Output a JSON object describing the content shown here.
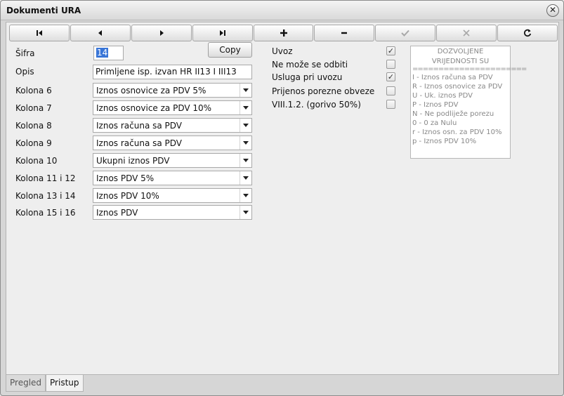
{
  "window": {
    "title": "Dokumenti URA",
    "close_label": "✕"
  },
  "toolbar": {
    "buttons": [
      {
        "name": "first-record-button",
        "icon": "first-icon"
      },
      {
        "name": "prev-record-button",
        "icon": "prev-icon"
      },
      {
        "name": "next-record-button",
        "icon": "next-icon"
      },
      {
        "name": "last-record-button",
        "icon": "last-icon"
      },
      {
        "name": "add-record-button",
        "icon": "plus-icon"
      },
      {
        "name": "delete-record-button",
        "icon": "minus-icon"
      },
      {
        "name": "confirm-button",
        "icon": "check-icon"
      },
      {
        "name": "cancel-button",
        "icon": "x-icon"
      },
      {
        "name": "refresh-button",
        "icon": "refresh-icon"
      }
    ]
  },
  "form": {
    "sifra_label": "Šifra",
    "sifra_value": "14",
    "opis_label": "Opis",
    "opis_value": "Primljene isp. izvan HR II13 I III13",
    "copy_label": "Copy",
    "kolone": [
      {
        "label": "Kolona 6",
        "value": "Iznos osnovice za PDV 5%"
      },
      {
        "label": "Kolona 7",
        "value": "Iznos osnovice za PDV 10%"
      },
      {
        "label": "Kolona 8",
        "value": "Iznos računa sa PDV"
      },
      {
        "label": "Kolona 9",
        "value": "Iznos računa sa PDV"
      },
      {
        "label": "Kolona 10",
        "value": "Ukupni iznos PDV"
      },
      {
        "label": "Kolona 11 i 12",
        "value": "Iznos PDV 5%"
      },
      {
        "label": "Kolona 13 i 14",
        "value": "Iznos PDV 10%"
      },
      {
        "label": "Kolona 15 i 16",
        "value": "Iznos PDV"
      }
    ]
  },
  "checkboxes": [
    {
      "label": "Uvoz",
      "checked": true
    },
    {
      "label": "Ne može se odbiti",
      "checked": false
    },
    {
      "label": "Usluga pri uvozu",
      "checked": true
    },
    {
      "label": "Prijenos porezne obveze",
      "checked": false
    },
    {
      "label": "VIII.1.2. (gorivo 50%)",
      "checked": false
    }
  ],
  "info": {
    "header_1": "DOZVOLJENE",
    "header_2": "VRIJEDNOSTI SU",
    "separator": "======================",
    "lines": [
      "I   - Iznos računa sa PDV",
      "R - Iznos osnovice za PDV",
      "U - Uk. iznos PDV",
      "P - Iznos PDV",
      "N - Ne podliježe porezu",
      "0 - 0 za Nulu",
      "r - Iznos osn. za PDV 10%",
      "p - Iznos PDV 10%"
    ]
  },
  "tabs": [
    {
      "label": "Pregled",
      "active": false
    },
    {
      "label": "Pristup",
      "active": true
    }
  ],
  "check_mark": "✓"
}
